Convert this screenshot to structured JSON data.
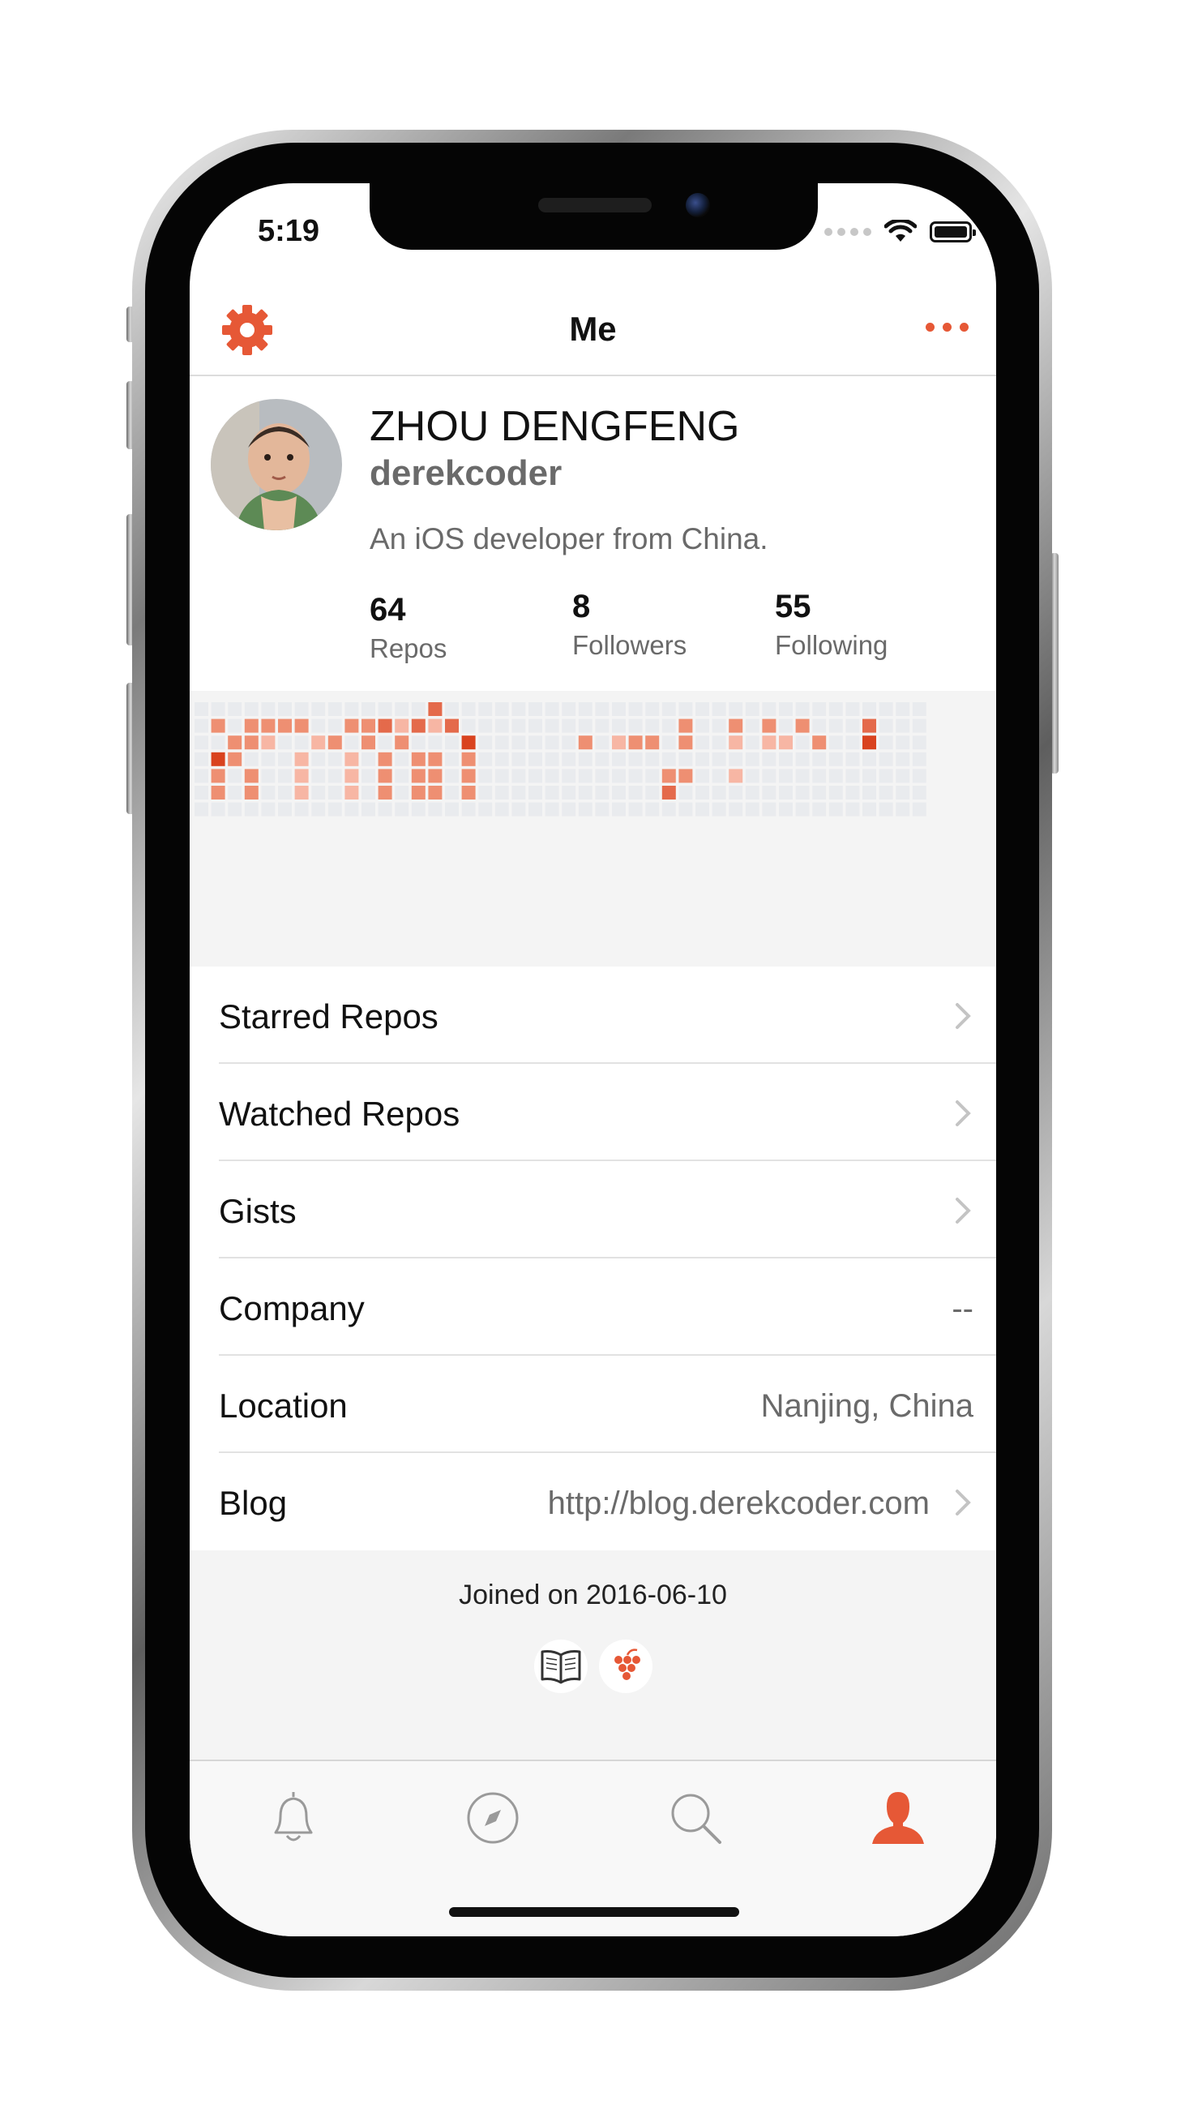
{
  "status_bar": {
    "time": "5:19"
  },
  "nav": {
    "title": "Me",
    "settings_icon": "gear-icon",
    "more_icon": "ellipsis-icon"
  },
  "colors": {
    "accent": "#e65836",
    "text": "#111111",
    "secondary": "#6a6a6a",
    "background": "#f4f4f4"
  },
  "profile": {
    "name": "ZHOU DENGFENG",
    "login": "derekcoder",
    "bio": "An iOS developer from China.",
    "stats": [
      {
        "value": "64",
        "label": "Repos"
      },
      {
        "value": "8",
        "label": "Followers"
      },
      {
        "value": "55",
        "label": "Following"
      }
    ]
  },
  "contributions": {
    "levels": [
      "00000000000000300000000000000000000000000000",
      "02022220022313130000000000000200202020003000",
      "00221001202020004000000201220200101102004000",
      "04200010010202202000000000000000000000000000",
      "02020010010202202000000000002200100000000000",
      "02020010010202202000000000003000000000000000",
      "00000000000000000000000000000000000000000000"
    ]
  },
  "list": [
    {
      "label": "Starred Repos",
      "value": "",
      "chevron": true
    },
    {
      "label": "Watched Repos",
      "value": "",
      "chevron": true
    },
    {
      "label": "Gists",
      "value": "",
      "chevron": true
    },
    {
      "label": "Company",
      "value": "--",
      "chevron": false
    },
    {
      "label": "Location",
      "value": "Nanjing, China",
      "chevron": false
    },
    {
      "label": "Blog",
      "value": "http://blog.derekcoder.com",
      "chevron": true
    }
  ],
  "footer": {
    "joined": "Joined on 2016-06-10",
    "icons": [
      "book-icon",
      "grapes-icon"
    ]
  },
  "tabs": [
    {
      "name": "notifications",
      "icon": "bell-icon",
      "active": false
    },
    {
      "name": "explore",
      "icon": "compass-icon",
      "active": false
    },
    {
      "name": "search",
      "icon": "search-icon",
      "active": false
    },
    {
      "name": "me",
      "icon": "person-icon",
      "active": true
    }
  ]
}
